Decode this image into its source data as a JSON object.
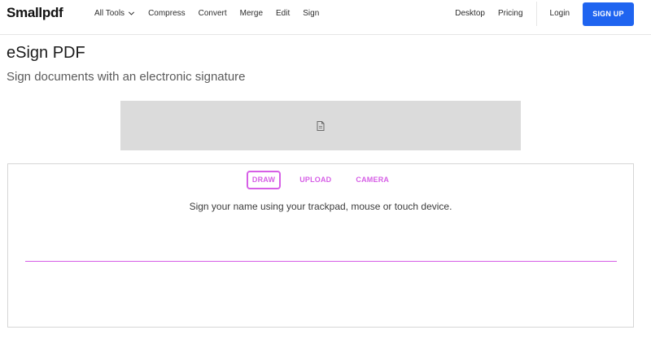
{
  "app": {
    "logo": "Smallpdf"
  },
  "nav": {
    "left": [
      {
        "label": "All Tools",
        "has_dropdown": true
      },
      {
        "label": "Compress"
      },
      {
        "label": "Convert"
      },
      {
        "label": "Merge"
      },
      {
        "label": "Edit"
      },
      {
        "label": "Sign"
      }
    ],
    "right": {
      "desktop": "Desktop",
      "pricing": "Pricing",
      "login": "Login",
      "signup": "SIGN UP"
    }
  },
  "page": {
    "title": "eSign PDF",
    "subtitle": "Sign documents with an electronic signature"
  },
  "placeholder": {
    "icon": "document-icon"
  },
  "signature": {
    "tabs": [
      {
        "label": "DRAW",
        "active": true
      },
      {
        "label": "UPLOAD",
        "active": false
      },
      {
        "label": "CAMERA",
        "active": false
      }
    ],
    "instructions": "Sign your name using your trackpad, mouse or touch device."
  },
  "colors": {
    "brand_blue": "#1f64f0",
    "accent_pink": "#d65fe6",
    "placeholder_gray": "#dbdbdb"
  }
}
